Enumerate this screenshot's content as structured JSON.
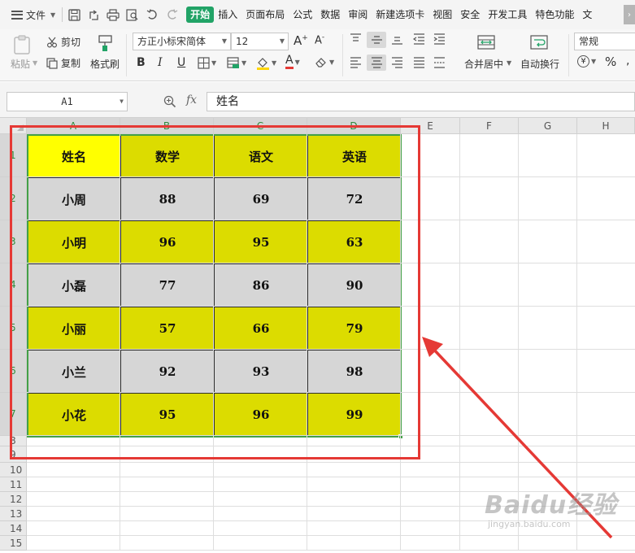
{
  "menubar": {
    "file_label": "文件",
    "tabs": [
      "开始",
      "插入",
      "页面布局",
      "公式",
      "数据",
      "审阅",
      "新建选项卡",
      "视图",
      "安全",
      "开发工具",
      "特色功能",
      "文"
    ],
    "active_tab": "开始"
  },
  "ribbon": {
    "paste_label": "粘贴",
    "cut_label": "剪切",
    "copy_label": "复制",
    "format_painter_label": "格式刷",
    "font_name": "方正小标宋简体",
    "font_size": "12",
    "merge_center_label": "合并居中",
    "wrap_text_label": "自动换行",
    "number_format": "常规"
  },
  "formula_bar": {
    "cell_ref": "A1",
    "fx_label": "fx",
    "formula_value": "姓名"
  },
  "sheet": {
    "columns": [
      "A",
      "B",
      "C",
      "D",
      "E",
      "F",
      "G",
      "H"
    ],
    "rows": [
      "1",
      "2",
      "3",
      "4",
      "5",
      "6",
      "7",
      "8",
      "9",
      "10",
      "11",
      "12",
      "13",
      "14",
      "15"
    ],
    "table": [
      [
        "姓名",
        "数学",
        "语文",
        "英语"
      ],
      [
        "小周",
        "88",
        "69",
        "72"
      ],
      [
        "小明",
        "96",
        "95",
        "63"
      ],
      [
        "小磊",
        "77",
        "86",
        "90"
      ],
      [
        "小丽",
        "57",
        "66",
        "79"
      ],
      [
        "小兰",
        "92",
        "93",
        "98"
      ],
      [
        "小花",
        "95",
        "96",
        "99"
      ]
    ]
  },
  "colors": {
    "header_a1": "#ffff00",
    "olive": "#dcdc00",
    "gray": "#d6d6d6",
    "annotation": "#e53935",
    "selection": "#43a047",
    "active_tab": "#21a366"
  },
  "watermark": {
    "main": "Baidu经验",
    "sub": "jingyan.baidu.com"
  }
}
